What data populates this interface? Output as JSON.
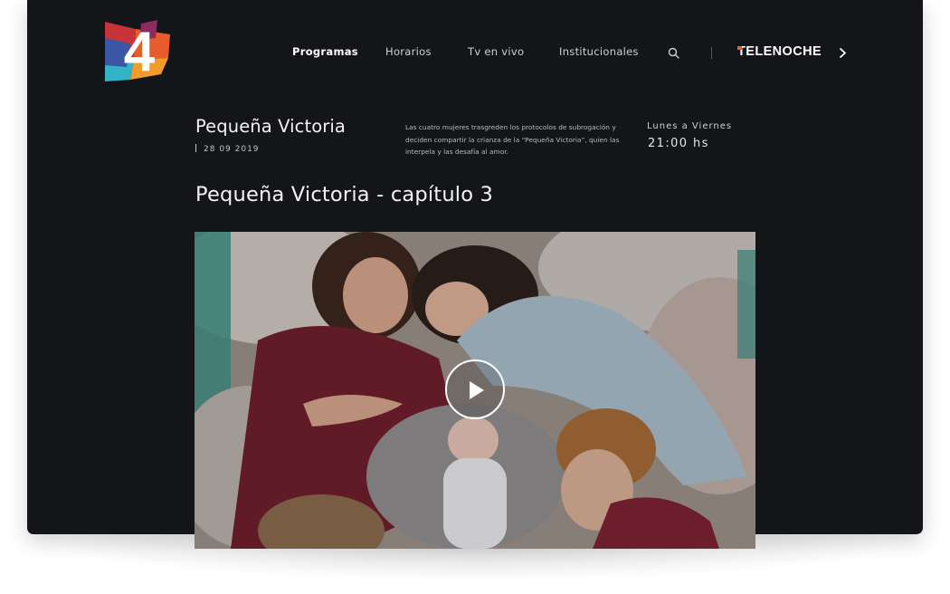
{
  "nav": {
    "items": [
      {
        "label": "Programas",
        "active": true
      },
      {
        "label": "Horarios",
        "active": false
      },
      {
        "label": "Tv en vivo",
        "active": false
      },
      {
        "label": "Institucionales",
        "active": false
      }
    ],
    "brand_rest": "ELENOCHE",
    "brand_first": "T"
  },
  "logo": {
    "text": "4",
    "colors": [
      "#e23b35",
      "#2f56a6",
      "#35b7c8",
      "#f47b20",
      "#8a2b6e"
    ]
  },
  "show": {
    "title": "Pequeña Victoria",
    "date": "28 09 2019",
    "description": "Las cuatro mujeres trasgreden los protocolos de subrogación y deciden compartir la crianza de la “Pequeña Victoria”, quien las interpela y las desafía al amor.",
    "schedule_days": "Lunes a Viernes",
    "schedule_time": "21:00 hs"
  },
  "episode": {
    "title": "Pequeña Victoria - capítulo 3"
  },
  "icons": {
    "search": "search-icon",
    "chevron": "chevron-right-icon",
    "play": "play-icon"
  },
  "colors": {
    "background": "#141519",
    "accent": "#e9602a"
  }
}
